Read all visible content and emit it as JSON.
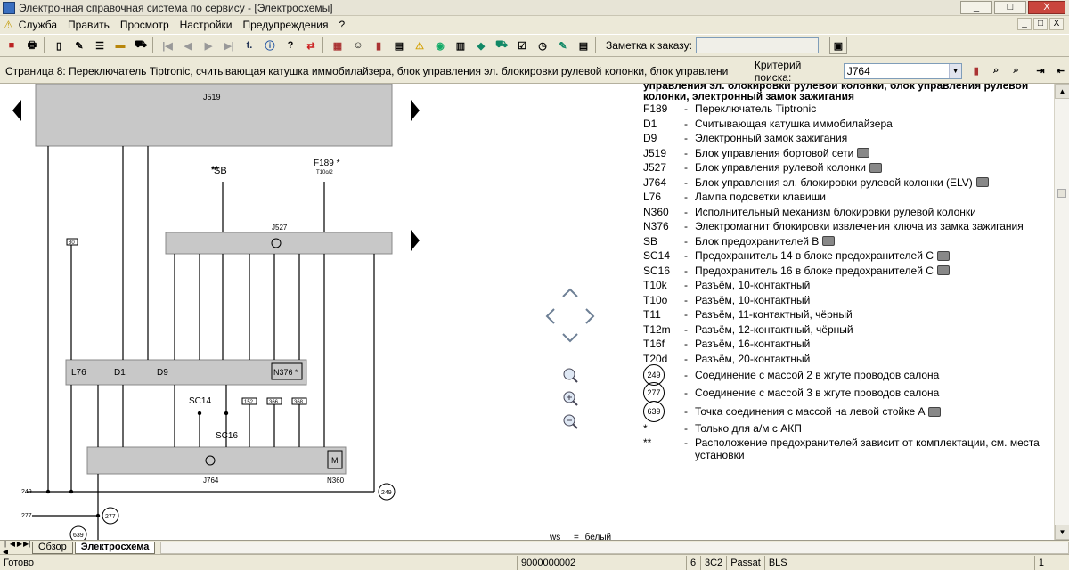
{
  "window": {
    "title": "Электронная справочная система по сервису - [Электросхемы]",
    "minimize": "_",
    "maximize": "□",
    "close": "X"
  },
  "menu": {
    "items": [
      "Служба",
      "Править",
      "Просмотр",
      "Настройки",
      "Предупреждения",
      "?"
    ],
    "right_buttons": [
      "_",
      "□",
      "X"
    ]
  },
  "toolbar": {
    "order_note_label": "Заметка к заказу:",
    "order_note_value": ""
  },
  "address": {
    "page_title": "Страница 8: Переключатель Tiptronic, считывающая катушка иммобилайзера, блок управления эл. блокировки рулевой колонки, блок управления рулевой колонки,",
    "criterion_label": "Критерий поиска:",
    "criterion_value": "J764"
  },
  "legend": {
    "title": "управления эл. блокировки рулевой колонки, блок управления рулевой колонки, электронный замок зажигания",
    "rows": [
      {
        "code": "F189",
        "desc": "Переключатель Tiptronic",
        "photo": false
      },
      {
        "code": "D1",
        "desc": "Считывающая катушка иммобилайзера",
        "photo": false
      },
      {
        "code": "D9",
        "desc": "Электронный замок зажигания",
        "photo": false
      },
      {
        "code": "J519",
        "desc": "Блок управления бортовой сети",
        "photo": true
      },
      {
        "code": "J527",
        "desc": "Блок управления рулевой колонки",
        "photo": true
      },
      {
        "code": "J764",
        "desc": "Блок управления эл. блокировки рулевой колонки (ELV)",
        "photo": true
      },
      {
        "code": "L76",
        "desc": "Лампа подсветки клавиши",
        "photo": false
      },
      {
        "code": "N360",
        "desc": "Исполнительный механизм блокировки рулевой колонки",
        "photo": false
      },
      {
        "code": "N376",
        "desc": "Электромагнит блокировки извлечения ключа из замка зажигания",
        "photo": false
      },
      {
        "code": "SB",
        "desc": "Блок предохранителей В",
        "photo": true
      },
      {
        "code": "SC14",
        "desc": "Предохранитель 14 в блоке предохранителей С",
        "photo": true
      },
      {
        "code": "SC16",
        "desc": "Предохранитель 16 в блоке предохранителей С",
        "photo": true
      },
      {
        "code": "T10k",
        "desc": "Разъём, 10-контактный",
        "photo": false
      },
      {
        "code": "T10o",
        "desc": "Разъём, 10-контактный",
        "photo": false
      },
      {
        "code": "T11",
        "desc": "Разъём, 11-контактный, чёрный",
        "photo": false
      },
      {
        "code": "T12m",
        "desc": "Разъём, 12-контактный, чёрный",
        "photo": false
      },
      {
        "code": "T16f",
        "desc": "Разъём, 16-контактный",
        "photo": false
      },
      {
        "code": "T20d",
        "desc": "Разъём, 20-контактный",
        "photo": false
      }
    ],
    "grounds": [
      {
        "num": "249",
        "desc": "Соединение с массой 2 в жгуте проводов салона",
        "photo": false
      },
      {
        "num": "277",
        "desc": "Соединение с массой 3 в жгуте проводов салона",
        "photo": false
      },
      {
        "num": "639",
        "desc": "Точка соединения с массой на левой стойке A",
        "photo": true
      }
    ],
    "notes": [
      {
        "code": "*",
        "desc": "Только для а/м с АКП"
      },
      {
        "code": "**",
        "desc": "Расположение предохранителей зависит от комплектации, см. места установки"
      }
    ],
    "footer_abbrev": "ws",
    "footer_eq": "=",
    "footer_meaning": "белый"
  },
  "schematic": {
    "j519": "J519",
    "j527": "J527",
    "j764": "J764",
    "sb": "SB",
    "sb_mark": "**",
    "f189": "F189 *",
    "f189_conn": "T10o/2",
    "sc14": "SC14",
    "sc16": "SC16",
    "l76": "L76",
    "d1": "D1",
    "d9": "D9",
    "n376": "N376 *",
    "n360": "N360",
    "m": "M",
    "g249": "249",
    "g277": "277",
    "g639": "639",
    "fuse80": "80",
    "fuse152": "152",
    "fuse366": "366",
    "fuse368": "368"
  },
  "tabs": {
    "items": [
      "Обзор",
      "Электросхема"
    ],
    "active": "Электросхема"
  },
  "status": {
    "ready": "Готово",
    "order": "9000000002",
    "page": "6",
    "model_code": "3C2",
    "model": "Passat",
    "engine": "BLS",
    "extra": "1"
  },
  "colors": {
    "chrome": "#ece9d8",
    "block_fill": "#c8c8c8"
  }
}
